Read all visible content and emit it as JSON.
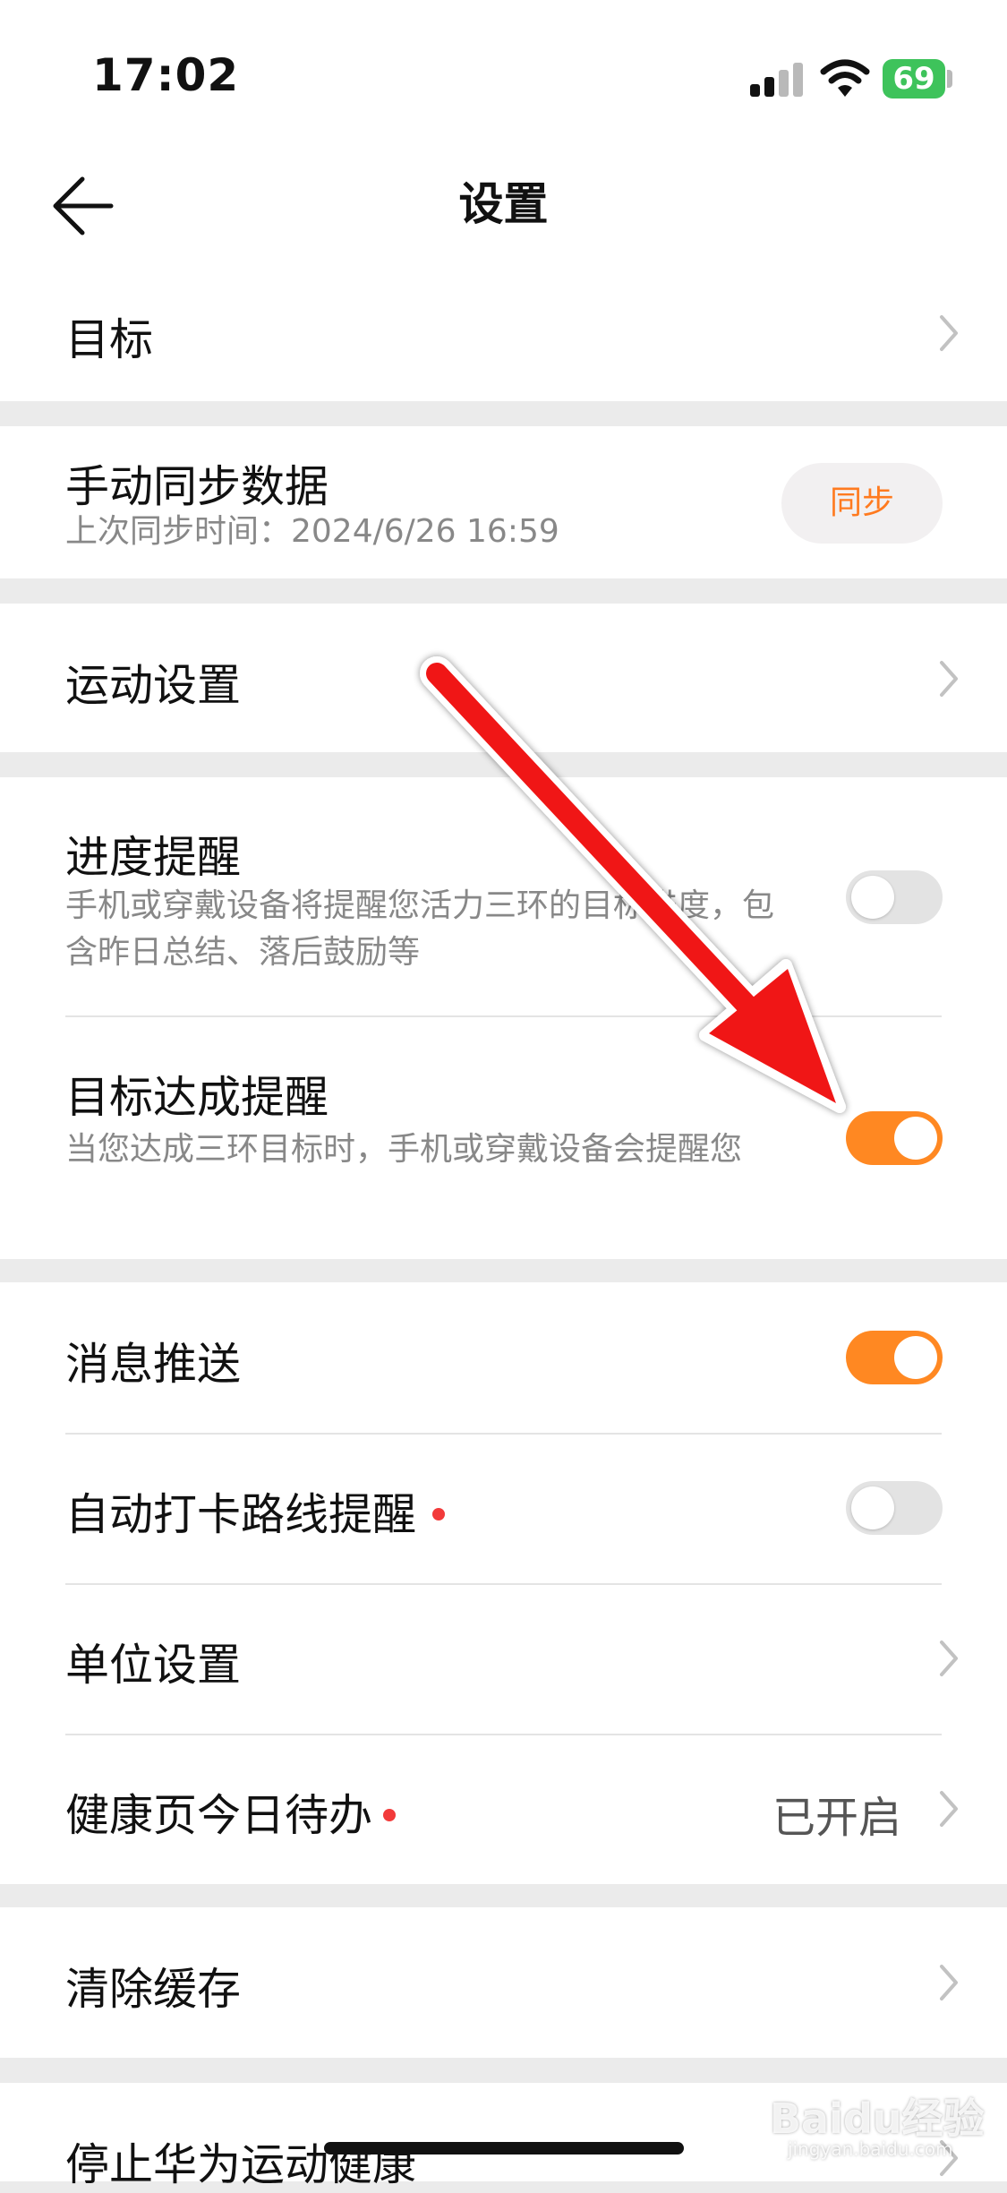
{
  "status_bar": {
    "time": "17:02",
    "battery": "69"
  },
  "nav": {
    "title": "设置",
    "back_icon": "arrow-left-icon"
  },
  "goal": {
    "label": "目标"
  },
  "sync": {
    "label": "手动同步数据",
    "subtitle": "上次同步时间：2024/6/26 16:59",
    "button": "同步"
  },
  "sport_settings": {
    "label": "运动设置"
  },
  "progress_reminder": {
    "label": "进度提醒",
    "desc": "手机或穿戴设备将提醒您活力三环的目标进度，包含昨日总结、落后鼓励等",
    "enabled": false
  },
  "goal_reminder": {
    "label": "目标达成提醒",
    "desc": "当您达成三环目标时，手机或穿戴设备会提醒您",
    "enabled": true
  },
  "message_push": {
    "label": "消息推送",
    "enabled": true
  },
  "auto_checkin": {
    "label": "自动打卡路线提醒",
    "enabled": false,
    "has_badge": true
  },
  "unit_settings": {
    "label": "单位设置"
  },
  "health_todo": {
    "label": "健康页今日待办",
    "value": "已开启",
    "has_badge": true
  },
  "clear_cache": {
    "label": "清除缓存"
  },
  "stop_service": {
    "label": "停止华为运动健康"
  },
  "watermark": {
    "brand": "Baidu经验",
    "url": "jingyan.baidu.com"
  },
  "colors": {
    "accent": "#ff8822",
    "badge": "#f23a3a",
    "toggle_off": "#e3e3e3",
    "arrow": "#f01818"
  }
}
